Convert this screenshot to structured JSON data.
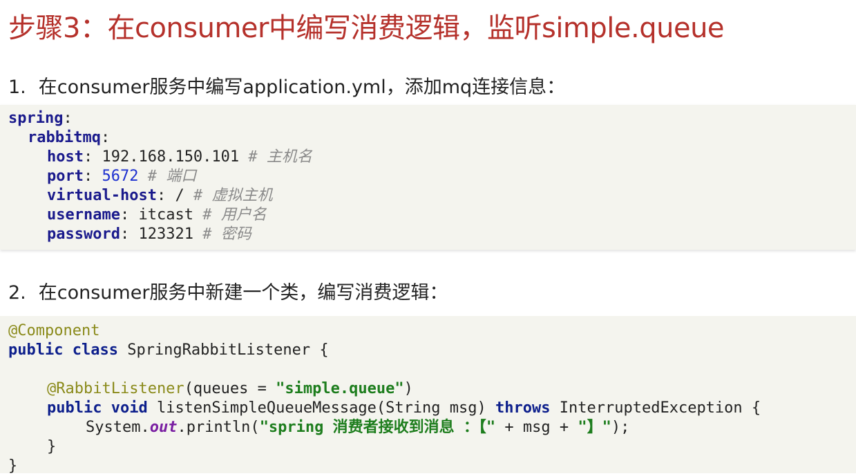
{
  "title": "步骤3：在consumer中编写消费逻辑，监听simple.queue",
  "step1": {
    "num": "1.",
    "text": "在consumer服务中编写application.yml，添加mq连接信息："
  },
  "yaml": {
    "spring_key": "spring",
    "colon": ":",
    "rabbitmq_key": "rabbitmq",
    "host_key": "host",
    "host_val": "192.168.150.101",
    "host_cmt": "# 主机名",
    "port_key": "port",
    "port_val": "5672",
    "port_cmt": "# 端口",
    "vhost_key": "virtual-host",
    "vhost_val": "/",
    "vhost_cmt": "# 虚拟主机",
    "user_key": "username",
    "user_val": "itcast",
    "user_cmt": "# 用户名",
    "pass_key": "password",
    "pass_val": "123321",
    "pass_cmt": "# 密码"
  },
  "step2": {
    "num": "2.",
    "text": "在consumer服务中新建一个类，编写消费逻辑："
  },
  "java": {
    "l1_ann": "@Component",
    "l2_kw": "public class",
    "l2_rest": " SpringRabbitListener {",
    "l4_ann": "@RabbitListener",
    "l4_a": "(queues = ",
    "l4_str": "\"simple.queue\"",
    "l4_b": ")",
    "l5_kw1": "public void",
    "l5_a": " listenSimpleQueueMessage(String msg) ",
    "l5_kw2": "throws",
    "l5_b": " InterruptedException {",
    "l6_a": "System.",
    "l6_field": "out",
    "l6_b": ".println(",
    "l6_str1": "\"spring 消费者接收到消息 ：【\"",
    "l6_c": " + msg + ",
    "l6_str2": "\"】\"",
    "l6_d": ");",
    "l7": "}",
    "l8": "}"
  }
}
